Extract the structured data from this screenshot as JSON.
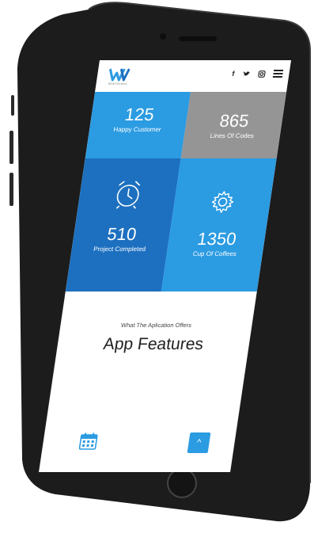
{
  "brand": {
    "logo_text": "W",
    "subtitle": "WebThemez"
  },
  "social": {
    "facebook": "f",
    "twitter": "t",
    "instagram": "ig"
  },
  "stats": [
    {
      "value": "125",
      "label": "Happy Customer"
    },
    {
      "value": "865",
      "label": "Lines Of Codes"
    },
    {
      "value": "510",
      "label": "Project Completed"
    },
    {
      "value": "1350",
      "label": "Cup Of Coffees"
    }
  ],
  "features": {
    "eyebrow": "What The Aplication Offers",
    "title": "App Features"
  },
  "back_to_top": {
    "label": "^"
  },
  "colors": {
    "blue": "#2b9be2",
    "dark_blue": "#1d70c0",
    "gray": "#959595",
    "phone": "#1c1c1c"
  }
}
